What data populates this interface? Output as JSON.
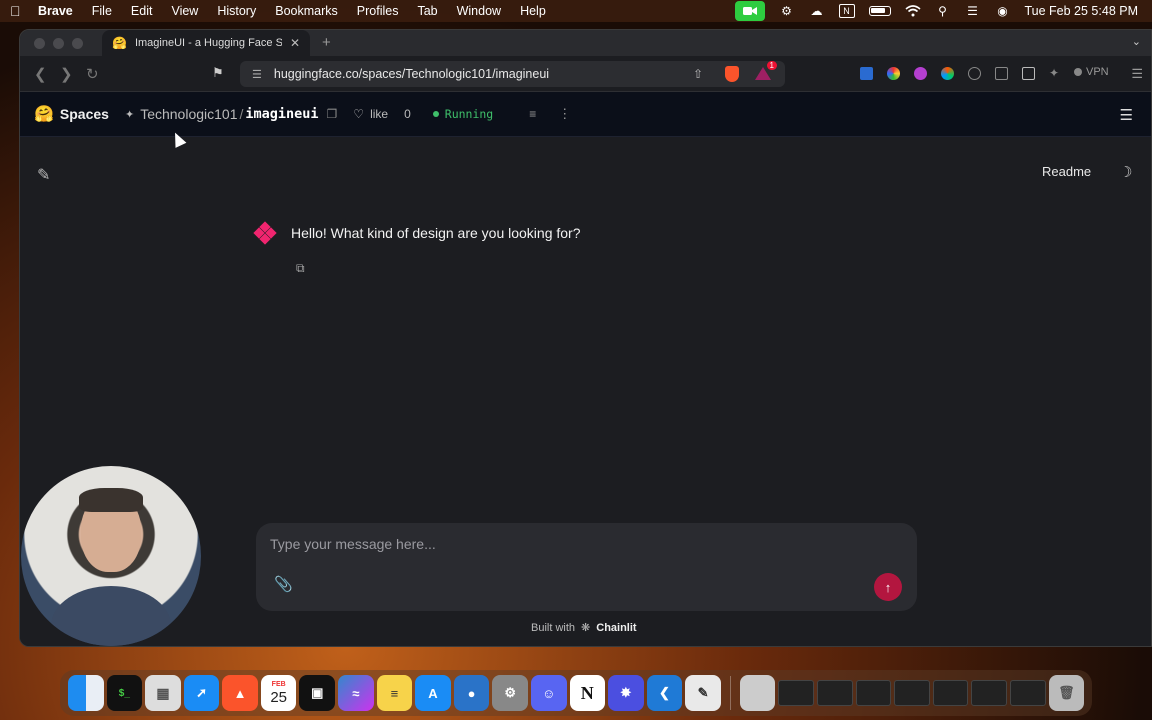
{
  "menubar": {
    "app_name": "Brave",
    "items": [
      "File",
      "Edit",
      "View",
      "History",
      "Bookmarks",
      "Profiles",
      "Tab",
      "Window",
      "Help"
    ],
    "clock": "Tue Feb 25  5:48 PM"
  },
  "browser": {
    "tab_title": "ImagineUI - a Hugging Face S",
    "url": "huggingface.co/spaces/Technologic101/imagineui",
    "vpn_label": "VPN",
    "rewards_badge": "1"
  },
  "hf": {
    "spaces_label": "Spaces",
    "owner": "Technologic101",
    "slash": "/",
    "repo": "imagineui",
    "like_label": "like",
    "like_count": "0",
    "status": "Running",
    "accent": "#3fbf6a"
  },
  "chat": {
    "readme_label": "Readme",
    "assistant_message": "Hello! What kind of design are you looking for?",
    "input_placeholder": "Type your message here...",
    "built_with": "Built with",
    "built_with_brand": "Chainlit",
    "send_color": "#b3163f"
  },
  "dock": {
    "calendar_month": "FEB",
    "calendar_day": "25"
  }
}
